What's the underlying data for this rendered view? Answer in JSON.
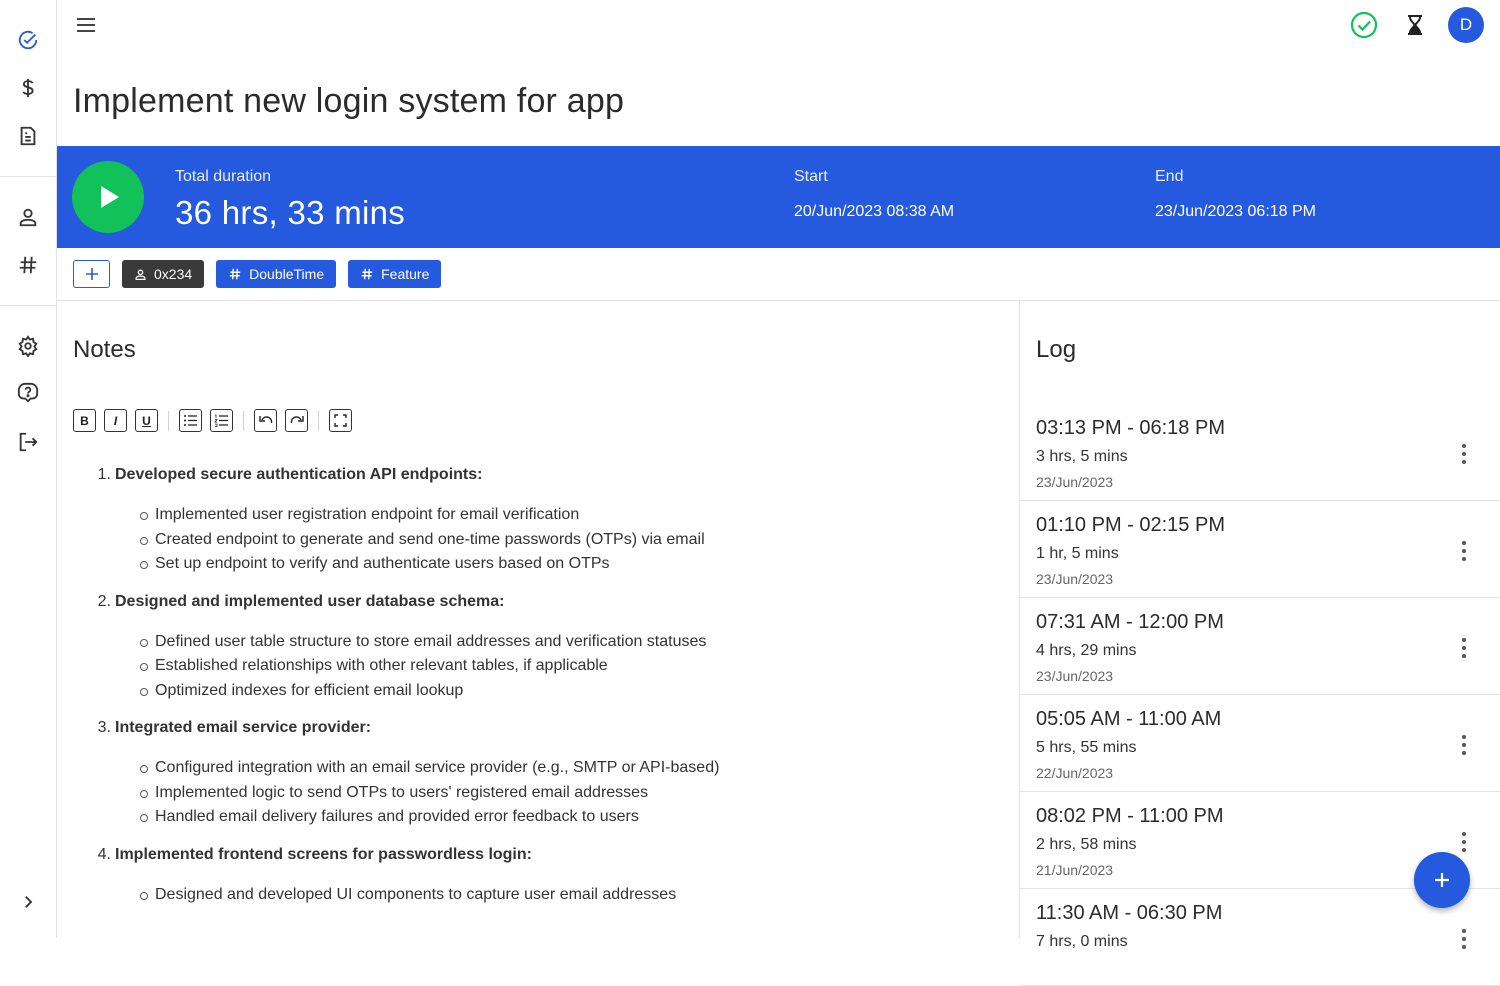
{
  "sidebar": {
    "icons": [
      "check-circle-icon",
      "dollar-icon",
      "file-icon",
      "person-icon",
      "hash-icon",
      "gear-icon",
      "help-icon",
      "logout-icon",
      "chevron-right-icon"
    ]
  },
  "header": {
    "avatar_initial": "D"
  },
  "page": {
    "title": "Implement new login system for app"
  },
  "banner": {
    "total_label": "Total duration",
    "total_value": "36 hrs, 33 mins",
    "start_label": "Start",
    "start_value": "20/Jun/2023 08:38 AM",
    "end_label": "End",
    "end_value": "23/Jun/2023 06:18 PM",
    "color": "#2559de",
    "play_color": "#12c15a"
  },
  "chips": [
    {
      "label": "0x234",
      "icon": "person-icon",
      "style": "dark"
    },
    {
      "label": "DoubleTime",
      "icon": "hash-icon",
      "style": "blue"
    },
    {
      "label": "Feature",
      "icon": "hash-icon",
      "style": "blue"
    }
  ],
  "notes": {
    "title": "Notes",
    "toolbar": [
      "B",
      "I",
      "U"
    ],
    "items": [
      {
        "num": "1.",
        "heading": "Developed secure authentication API endpoints:",
        "subs": [
          "Implemented user registration endpoint for email verification",
          "Created endpoint to generate and send one-time passwords (OTPs) via email",
          "Set up endpoint to verify and authenticate users based on OTPs"
        ]
      },
      {
        "num": "2.",
        "heading": "Designed and implemented user database schema:",
        "subs": [
          "Defined user table structure to store email addresses and verification statuses",
          "Established relationships with other relevant tables, if applicable",
          "Optimized indexes for efficient email lookup"
        ]
      },
      {
        "num": "3.",
        "heading": "Integrated email service provider:",
        "subs": [
          "Configured integration with an email service provider (e.g., SMTP or API-based)",
          "Implemented logic to send OTPs to users' registered email addresses",
          "Handled email delivery failures and provided error feedback to users"
        ]
      },
      {
        "num": "4.",
        "heading": "Implemented frontend screens for passwordless login:",
        "subs": [
          "Designed and developed UI components to capture user email addresses"
        ]
      }
    ]
  },
  "log": {
    "title": "Log",
    "entries": [
      {
        "range": "03:13 PM - 06:18 PM",
        "duration": "3 hrs, 5 mins",
        "date": "23/Jun/2023"
      },
      {
        "range": "01:10 PM - 02:15 PM",
        "duration": "1 hr, 5 mins",
        "date": "23/Jun/2023"
      },
      {
        "range": "07:31 AM - 12:00 PM",
        "duration": "4 hrs, 29 mins",
        "date": "23/Jun/2023"
      },
      {
        "range": "05:05 AM - 11:00 AM",
        "duration": "5 hrs, 55 mins",
        "date": "22/Jun/2023"
      },
      {
        "range": "08:02 PM - 11:00 PM",
        "duration": "2 hrs, 58 mins",
        "date": "21/Jun/2023"
      },
      {
        "range": "11:30 AM - 06:30 PM",
        "duration": "7 hrs, 0 mins",
        "date": ""
      }
    ]
  }
}
